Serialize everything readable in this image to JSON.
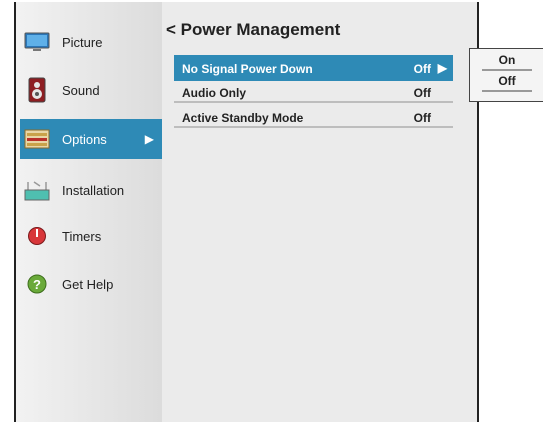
{
  "sidebar": {
    "items": [
      {
        "label": "Picture",
        "icon": "picture-icon"
      },
      {
        "label": "Sound",
        "icon": "speaker-icon"
      },
      {
        "label": "Options",
        "icon": "options-icon"
      },
      {
        "label": "Installation",
        "icon": "installation-icon"
      },
      {
        "label": "Timers",
        "icon": "timer-icon"
      },
      {
        "label": "Get Help",
        "icon": "help-icon"
      }
    ],
    "active_index": 2
  },
  "main": {
    "title": "< Power Management",
    "rows": [
      {
        "name": "No Signal Power Down",
        "value": "Off"
      },
      {
        "name": "Audio Only",
        "value": "Off"
      },
      {
        "name": "Active Standby Mode",
        "value": "Off"
      }
    ]
  },
  "popup": {
    "options": [
      "On",
      "Off"
    ]
  },
  "colors": {
    "highlight": "#2e8ab6",
    "background": "#ebebeb"
  }
}
